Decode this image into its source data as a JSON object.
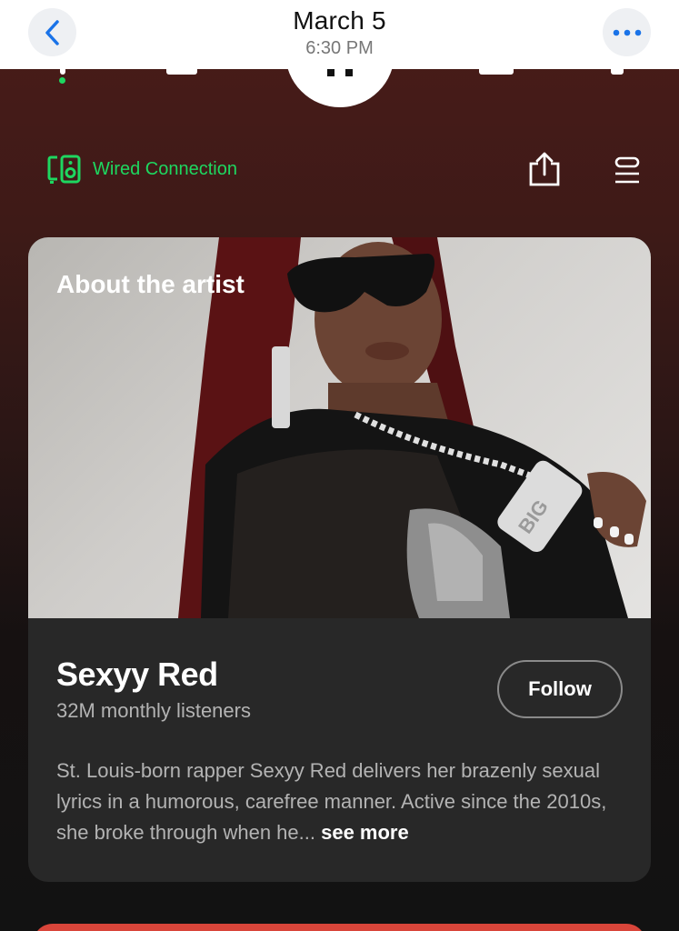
{
  "header": {
    "title": "March 5",
    "subtitle": "6:30 PM"
  },
  "device": {
    "connection_label": "Wired Connection"
  },
  "artist_card": {
    "section_title": "About the artist",
    "artist_name": "Sexyy Red",
    "monthly_listeners": "32M monthly listeners",
    "follow_label": "Follow",
    "bio": "St. Louis-born rapper Sexyy Red delivers her brazenly sexual lyrics in a humorous, carefree manner. Active since the 2010s, she broke through when he...",
    "see_more_label": "see more"
  },
  "colors": {
    "accent_green": "#1ed760",
    "card_bg": "#282828",
    "header_bg": "#ffffff",
    "ios_blue": "#1a73e8"
  },
  "icons": [
    "back-chevron-icon",
    "more-dots-icon",
    "speaker-device-icon",
    "share-icon",
    "queue-icon"
  ]
}
